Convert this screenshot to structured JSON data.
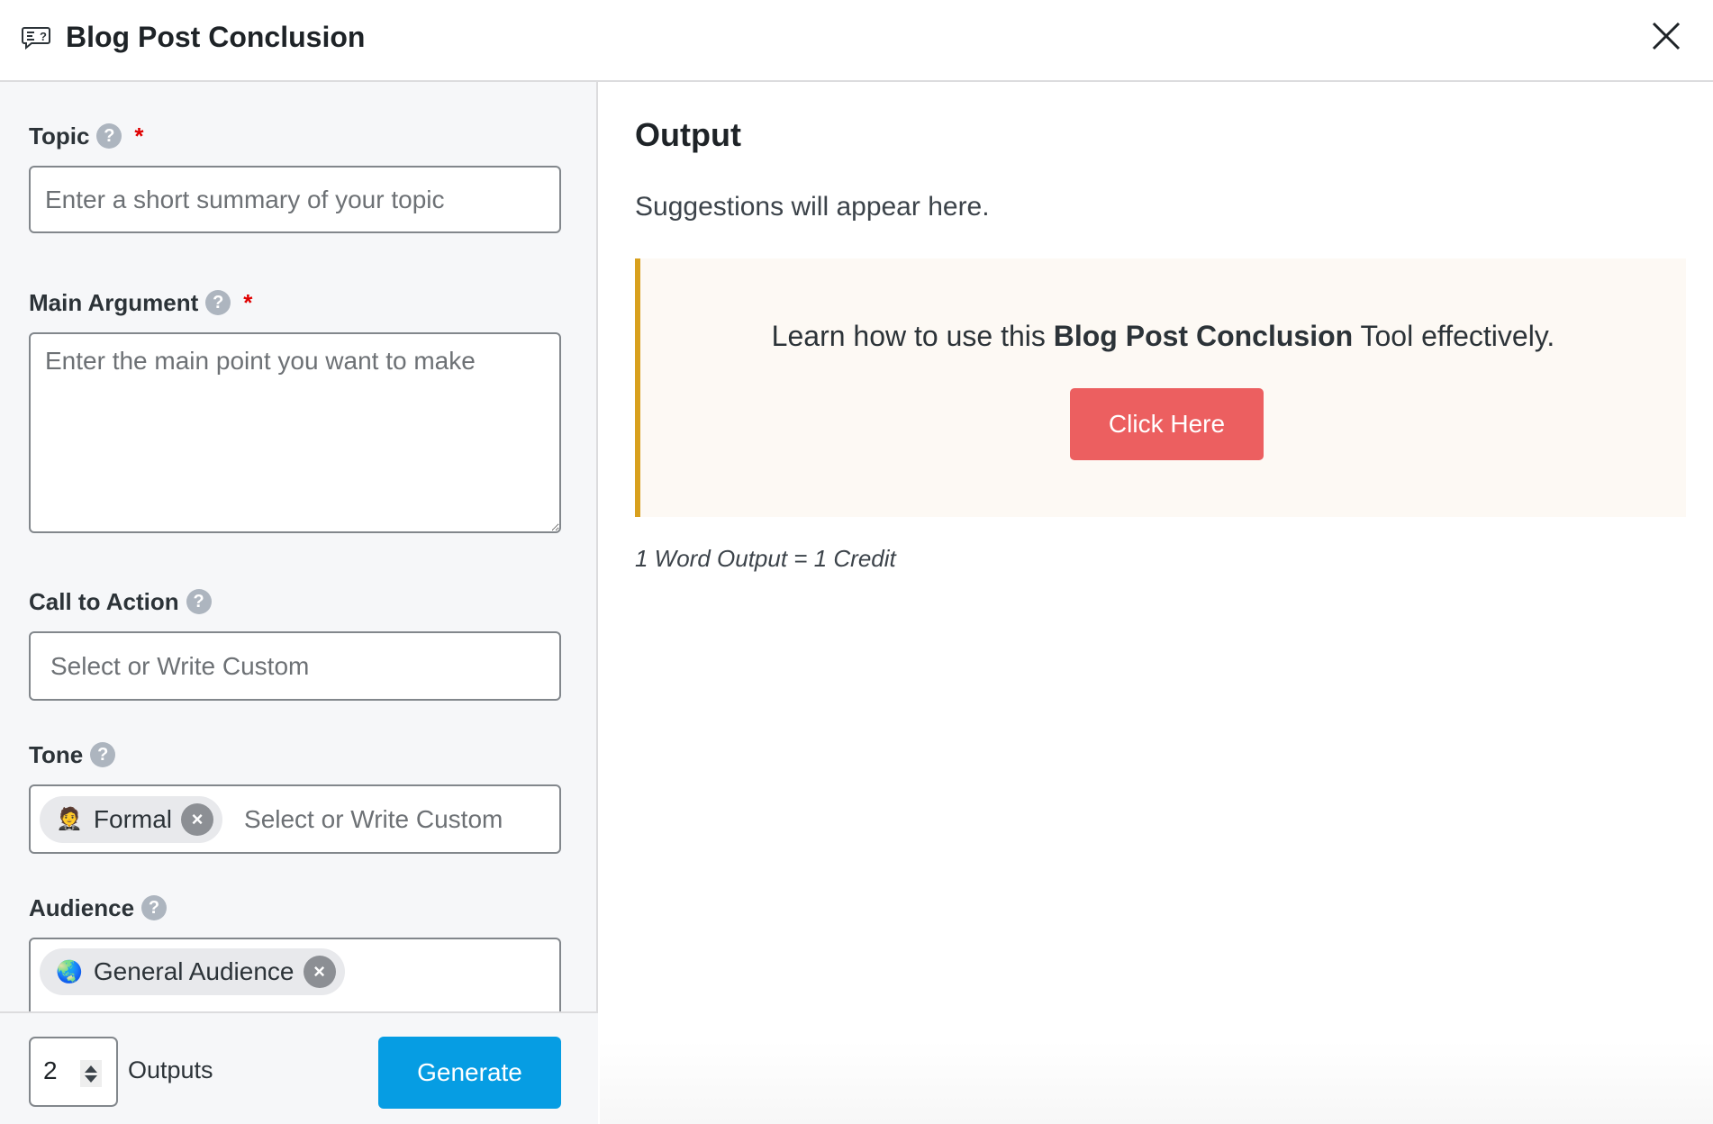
{
  "header": {
    "icon": "chat-question-icon",
    "title": "Blog Post Conclusion",
    "close_icon": "close-icon"
  },
  "form": {
    "topic": {
      "label": "Topic",
      "required_marker": "*",
      "help": "?",
      "placeholder": "Enter a short summary of your topic",
      "value": ""
    },
    "main_argument": {
      "label": "Main Argument",
      "required_marker": "*",
      "help": "?",
      "placeholder": "Enter the main point you want to make",
      "value": ""
    },
    "call_to_action": {
      "label": "Call to Action",
      "help": "?",
      "placeholder": "Select or Write Custom",
      "value": ""
    },
    "tone": {
      "label": "Tone",
      "help": "?",
      "selected": [
        {
          "emoji": "🤵",
          "label": "Formal",
          "remove": "×"
        }
      ],
      "placeholder": "Select or Write Custom"
    },
    "audience": {
      "label": "Audience",
      "help": "?",
      "selected": [
        {
          "emoji": "🌏",
          "label": "General Audience",
          "remove": "×"
        }
      ]
    }
  },
  "footer": {
    "outputs_count": "2",
    "outputs_label": "Outputs",
    "generate_label": "Generate"
  },
  "output": {
    "title": "Output",
    "empty_message": "Suggestions will appear here.",
    "callout": {
      "text_before": "Learn how to use this ",
      "text_bold": "Blog Post Conclusion",
      "text_after": " Tool effectively.",
      "button_label": "Click Here"
    },
    "credit_note": "1 Word Output = 1 Credit"
  },
  "colors": {
    "primary_button": "#069de3",
    "callout_button": "#ec5f60",
    "callout_accent": "#d8a01e",
    "callout_bg": "#fdf9f4",
    "required": "#e00000",
    "panel_bg": "#f6f7f9"
  }
}
